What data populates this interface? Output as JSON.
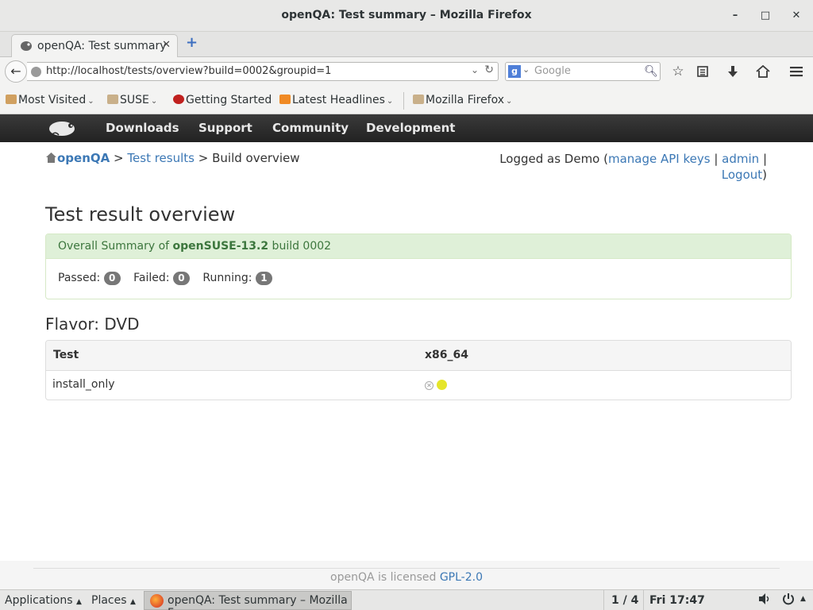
{
  "window": {
    "title": "openQA: Test summary – Mozilla Firefox",
    "minimize": "–",
    "maximize": "□",
    "close": "✕"
  },
  "tabs": [
    {
      "label": "openQA: Test summary",
      "close": "✕"
    }
  ],
  "toolbar": {
    "back": "←",
    "url": "http://localhost/tests/overview?build=0002&groupid=1",
    "url_dropdown": "⌄",
    "reload": "↻",
    "search_engine": "g",
    "search_placeholder": "Google",
    "new_tab": "+"
  },
  "bookmarks": [
    {
      "label": "Most Visited",
      "icon": "folder-icon"
    },
    {
      "label": "SUSE",
      "icon": "folder-icon"
    },
    {
      "label": "Getting Started",
      "icon": "chameleon-icon"
    },
    {
      "label": "Latest Headlines",
      "icon": "rss-icon"
    },
    {
      "label": "Mozilla Firefox",
      "icon": "folder-icon"
    }
  ],
  "site_nav": {
    "items": [
      "Downloads",
      "Support",
      "Community",
      "Development"
    ]
  },
  "breadcrumb": {
    "home": "openQA",
    "sep1": ">",
    "test_results": "Test results",
    "sep2": ">",
    "current": "Build overview"
  },
  "user": {
    "prefix": "Logged as Demo (",
    "manage_api_keys": "manage API keys",
    "sep1": " | ",
    "admin": "admin",
    "sep2": " |",
    "logout": "Logout",
    "suffix": ")"
  },
  "page": {
    "heading": "Test result overview",
    "summary": {
      "prefix": "Overall Summary of ",
      "distri": "openSUSE-13.2",
      "build_label": " build 0002",
      "passed_label": "Passed:",
      "passed": "0",
      "failed_label": "Failed:",
      "failed": "0",
      "running_label": "Running:",
      "running": "1"
    },
    "flavor": "Flavor: DVD",
    "table": {
      "col_test": "Test",
      "col_arch": "x86_64",
      "rows": [
        {
          "test": "install_only",
          "state": "running"
        }
      ]
    }
  },
  "footer": {
    "text": "openQA is licensed ",
    "license": "GPL-2.0"
  },
  "taskbar": {
    "applications": "Applications",
    "places": "Places",
    "task": "openQA: Test summary – Mozilla F...",
    "workspace": "1 / 4",
    "clock": "Fri 17:47"
  }
}
